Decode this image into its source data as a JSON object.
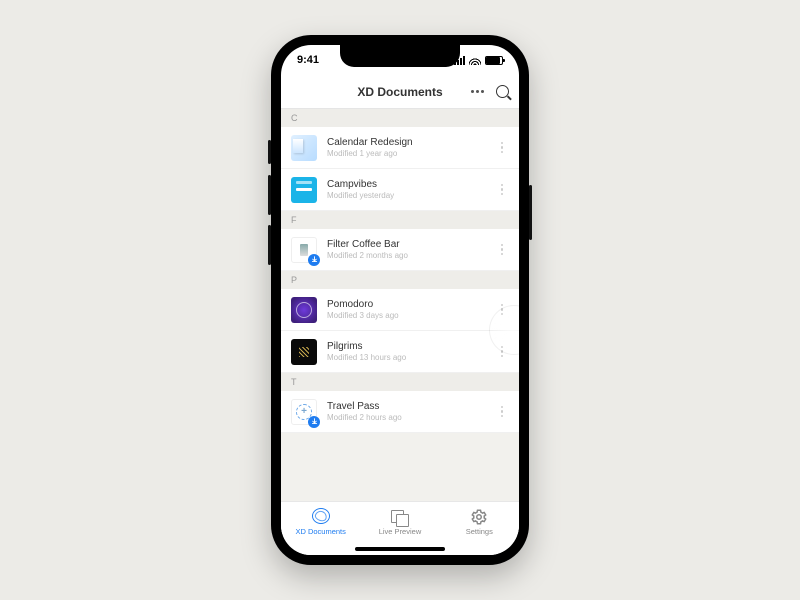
{
  "status_bar": {
    "time": "9:41"
  },
  "header": {
    "title": "XD Documents"
  },
  "sections": [
    {
      "letter": "C",
      "items": [
        {
          "title": "Calendar Redesign",
          "subtitle": "Modified 1 year ago"
        },
        {
          "title": "Campvibes",
          "subtitle": "Modified yesterday"
        }
      ]
    },
    {
      "letter": "F",
      "items": [
        {
          "title": "Filter Coffee Bar",
          "subtitle": "Modified 2 months ago"
        }
      ]
    },
    {
      "letter": "P",
      "items": [
        {
          "title": "Pomodoro",
          "subtitle": "Modified 3 days ago"
        },
        {
          "title": "Pilgrims",
          "subtitle": "Modified 13 hours ago"
        }
      ]
    },
    {
      "letter": "T",
      "items": [
        {
          "title": "Travel Pass",
          "subtitle": "Modified 2 hours ago"
        }
      ]
    }
  ],
  "tabs": {
    "documents": "XD Documents",
    "live": "Live Preview",
    "settings": "Settings"
  },
  "colors": {
    "accent": "#1e7cf0"
  }
}
